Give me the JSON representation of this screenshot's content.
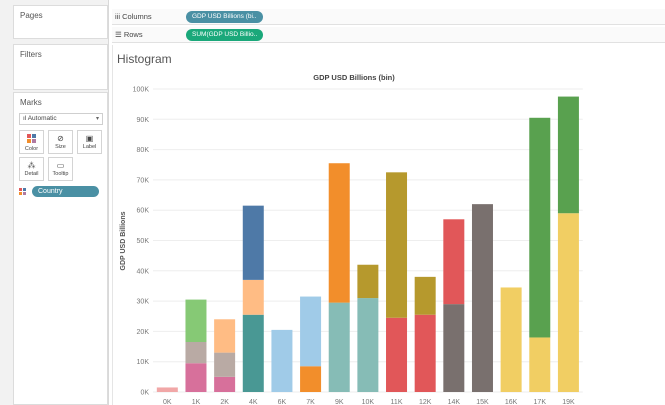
{
  "left_panel": {
    "pages": "Pages",
    "filters": "Filters",
    "marks": {
      "title": "Marks",
      "type": "Automatic",
      "buttons": [
        "Color",
        "Size",
        "Label",
        "Detail",
        "Tooltip"
      ],
      "pill": "Country"
    }
  },
  "shelves": {
    "columns_label": "Columns",
    "columns_pill": "GDP USD Billions (bi..",
    "rows_label": "Rows",
    "rows_pill": "SUM(GDP USD Billio.."
  },
  "view": {
    "title": "Histogram"
  },
  "colors": {
    "columns_pill": "#4a90a4",
    "rows_pill": "#1aa87a",
    "country_pill": "#4a90a4"
  },
  "chart_data": {
    "type": "bar",
    "stacked": true,
    "title": "GDP USD Billions (bin)",
    "ylabel": "GDP USD Billions",
    "xlabel": "",
    "ylim": [
      0,
      100000
    ],
    "yticks": [
      "0K",
      "10K",
      "20K",
      "30K",
      "40K",
      "50K",
      "60K",
      "70K",
      "80K",
      "90K",
      "100K"
    ],
    "categories": [
      "0K",
      "1K",
      "2K",
      "4K",
      "6K",
      "7K",
      "9K",
      "10K",
      "11K",
      "12K",
      "14K",
      "15K",
      "16K",
      "17K",
      "19K"
    ],
    "bars": [
      {
        "category": "0K",
        "segments": [
          {
            "value": 1500,
            "color": "#f1a7a7"
          }
        ]
      },
      {
        "category": "1K",
        "segments": [
          {
            "value": 9500,
            "color": "#d7709b"
          },
          {
            "value": 7000,
            "color": "#b9aaa4"
          },
          {
            "value": 14000,
            "color": "#86c975"
          }
        ]
      },
      {
        "category": "2K",
        "segments": [
          {
            "value": 5000,
            "color": "#d7709b"
          },
          {
            "value": 8000,
            "color": "#b9aaa4"
          },
          {
            "value": 11000,
            "color": "#ffbc84"
          }
        ]
      },
      {
        "category": "4K",
        "segments": [
          {
            "value": 25500,
            "color": "#499894"
          },
          {
            "value": 11500,
            "color": "#ffbc84"
          },
          {
            "value": 24500,
            "color": "#4e79a7"
          }
        ]
      },
      {
        "category": "6K",
        "segments": [
          {
            "value": 20500,
            "color": "#a0cbe8"
          }
        ]
      },
      {
        "category": "7K",
        "segments": [
          {
            "value": 8500,
            "color": "#f28e2b"
          },
          {
            "value": 23000,
            "color": "#a0cbe8"
          }
        ]
      },
      {
        "category": "9K",
        "segments": [
          {
            "value": 29500,
            "color": "#86bcb6"
          },
          {
            "value": 46000,
            "color": "#f28e2b"
          }
        ]
      },
      {
        "category": "10K",
        "segments": [
          {
            "value": 31000,
            "color": "#86bcb6"
          },
          {
            "value": 11000,
            "color": "#b6992d"
          }
        ]
      },
      {
        "category": "11K",
        "segments": [
          {
            "value": 24500,
            "color": "#e15759"
          },
          {
            "value": 48000,
            "color": "#b6992d"
          }
        ]
      },
      {
        "category": "12K",
        "segments": [
          {
            "value": 25500,
            "color": "#e15759"
          },
          {
            "value": 12500,
            "color": "#b6992d"
          }
        ]
      },
      {
        "category": "14K",
        "segments": [
          {
            "value": 29000,
            "color": "#79706e"
          },
          {
            "value": 28000,
            "color": "#e15759"
          }
        ]
      },
      {
        "category": "15K",
        "segments": [
          {
            "value": 62000,
            "color": "#79706e"
          }
        ]
      },
      {
        "category": "16K",
        "segments": [
          {
            "value": 34500,
            "color": "#f1ce63"
          }
        ]
      },
      {
        "category": "17K",
        "segments": [
          {
            "value": 18000,
            "color": "#f1ce63"
          },
          {
            "value": 72500,
            "color": "#59a14f"
          }
        ]
      },
      {
        "category": "19K",
        "segments": [
          {
            "value": 59000,
            "color": "#f1ce63"
          },
          {
            "value": 38500,
            "color": "#59a14f"
          }
        ]
      }
    ]
  }
}
